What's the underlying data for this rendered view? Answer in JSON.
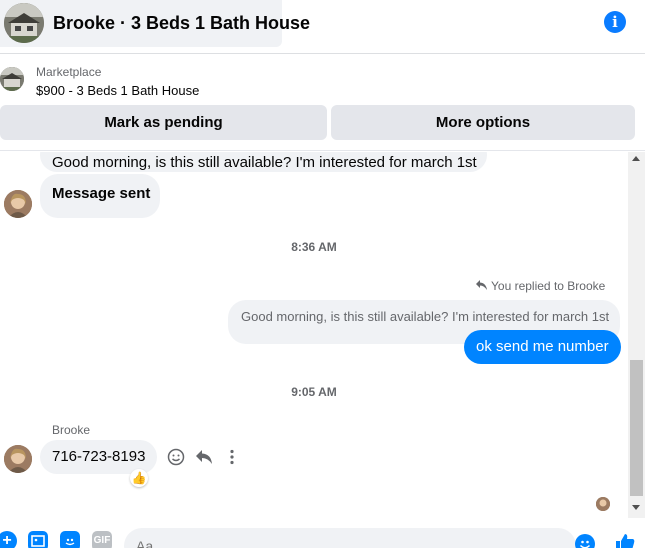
{
  "header": {
    "title": "Brooke · 3 Beds 1 Bath House",
    "avatar_icon": "house-photo",
    "info_icon": "info-icon",
    "info_glyph": "i"
  },
  "marketplace": {
    "label": "Marketplace",
    "listing": "$900 - 3 Beds 1 Bath House",
    "mark_pending_label": "Mark as pending",
    "more_options_label": "More options"
  },
  "messages": {
    "previous_text": "Good morning, is this still available? I'm interested for march 1st",
    "message_sent_text": "Message sent",
    "timestamp_1": "8:36 AM",
    "replied_label": "You replied to Brooke",
    "quoted_text": "Good morning, is this still available? I'm interested for march 1st",
    "outgoing_text": "ok send me number",
    "timestamp_2": "9:05 AM",
    "sender_name": "Brooke",
    "phone_text": "716-723-8193",
    "reaction_emoji": "👍"
  },
  "composer": {
    "placeholder": "Aa",
    "gif_label": "GIF"
  },
  "colors": {
    "accent": "#0084ff",
    "bubble_gray": "#f0f2f5",
    "button_gray": "#e4e6eb",
    "muted_text": "#65676b"
  }
}
